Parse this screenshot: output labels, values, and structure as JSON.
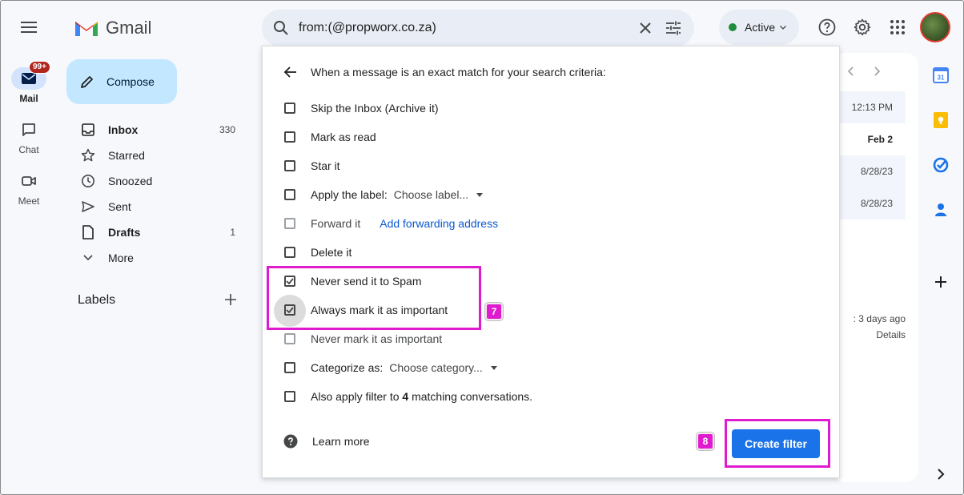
{
  "app": {
    "name": "Gmail"
  },
  "rail": {
    "mail": {
      "label": "Mail",
      "badge": "99+"
    },
    "chat": {
      "label": "Chat"
    },
    "meet": {
      "label": "Meet"
    }
  },
  "compose": {
    "label": "Compose"
  },
  "nav": {
    "items": [
      {
        "label": "Inbox",
        "count": "330",
        "icon": "inbox-icon"
      },
      {
        "label": "Starred",
        "count": "",
        "icon": "star-icon"
      },
      {
        "label": "Snoozed",
        "count": "",
        "icon": "clock-icon"
      },
      {
        "label": "Sent",
        "count": "",
        "icon": "send-icon"
      },
      {
        "label": "Drafts",
        "count": "1",
        "icon": "draft-icon"
      },
      {
        "label": "More",
        "count": "",
        "icon": "chevron-down-icon"
      }
    ],
    "labels_heading": "Labels"
  },
  "search": {
    "query": "from:(@propworx.co.za)"
  },
  "status": {
    "label": "Active",
    "color": "#1e8e3e"
  },
  "list": {
    "times": [
      "12:13 PM",
      "Feb 2",
      "8/28/23",
      "8/28/23"
    ],
    "activity": ": 3 days ago",
    "details": "Details"
  },
  "filter_dialog": {
    "heading": "When a message is an exact match for your search criteria:",
    "options": [
      {
        "label": "Skip the Inbox (Archive it)",
        "checked": false
      },
      {
        "label": "Mark as read",
        "checked": false
      },
      {
        "label": "Star it",
        "checked": false
      },
      {
        "label": "Apply the label:",
        "checked": false,
        "select": "Choose label..."
      },
      {
        "label": "Forward it",
        "checked": false,
        "link": "Add forwarding address"
      },
      {
        "label": "Delete it",
        "checked": false
      },
      {
        "label": "Never send it to Spam",
        "checked": true
      },
      {
        "label": "Always mark it as important",
        "checked": true
      },
      {
        "label": "Never mark it as important",
        "checked": false
      },
      {
        "label": "Categorize as:",
        "checked": false,
        "select": "Choose category..."
      },
      {
        "label_prefix": "Also apply filter to ",
        "label_count": "4",
        "label_suffix": " matching conversations.",
        "checked": false
      }
    ],
    "learn_more": "Learn more",
    "create_button": "Create filter"
  },
  "annotations": {
    "step7": "7",
    "step8": "8",
    "color": "#e01bcf"
  }
}
